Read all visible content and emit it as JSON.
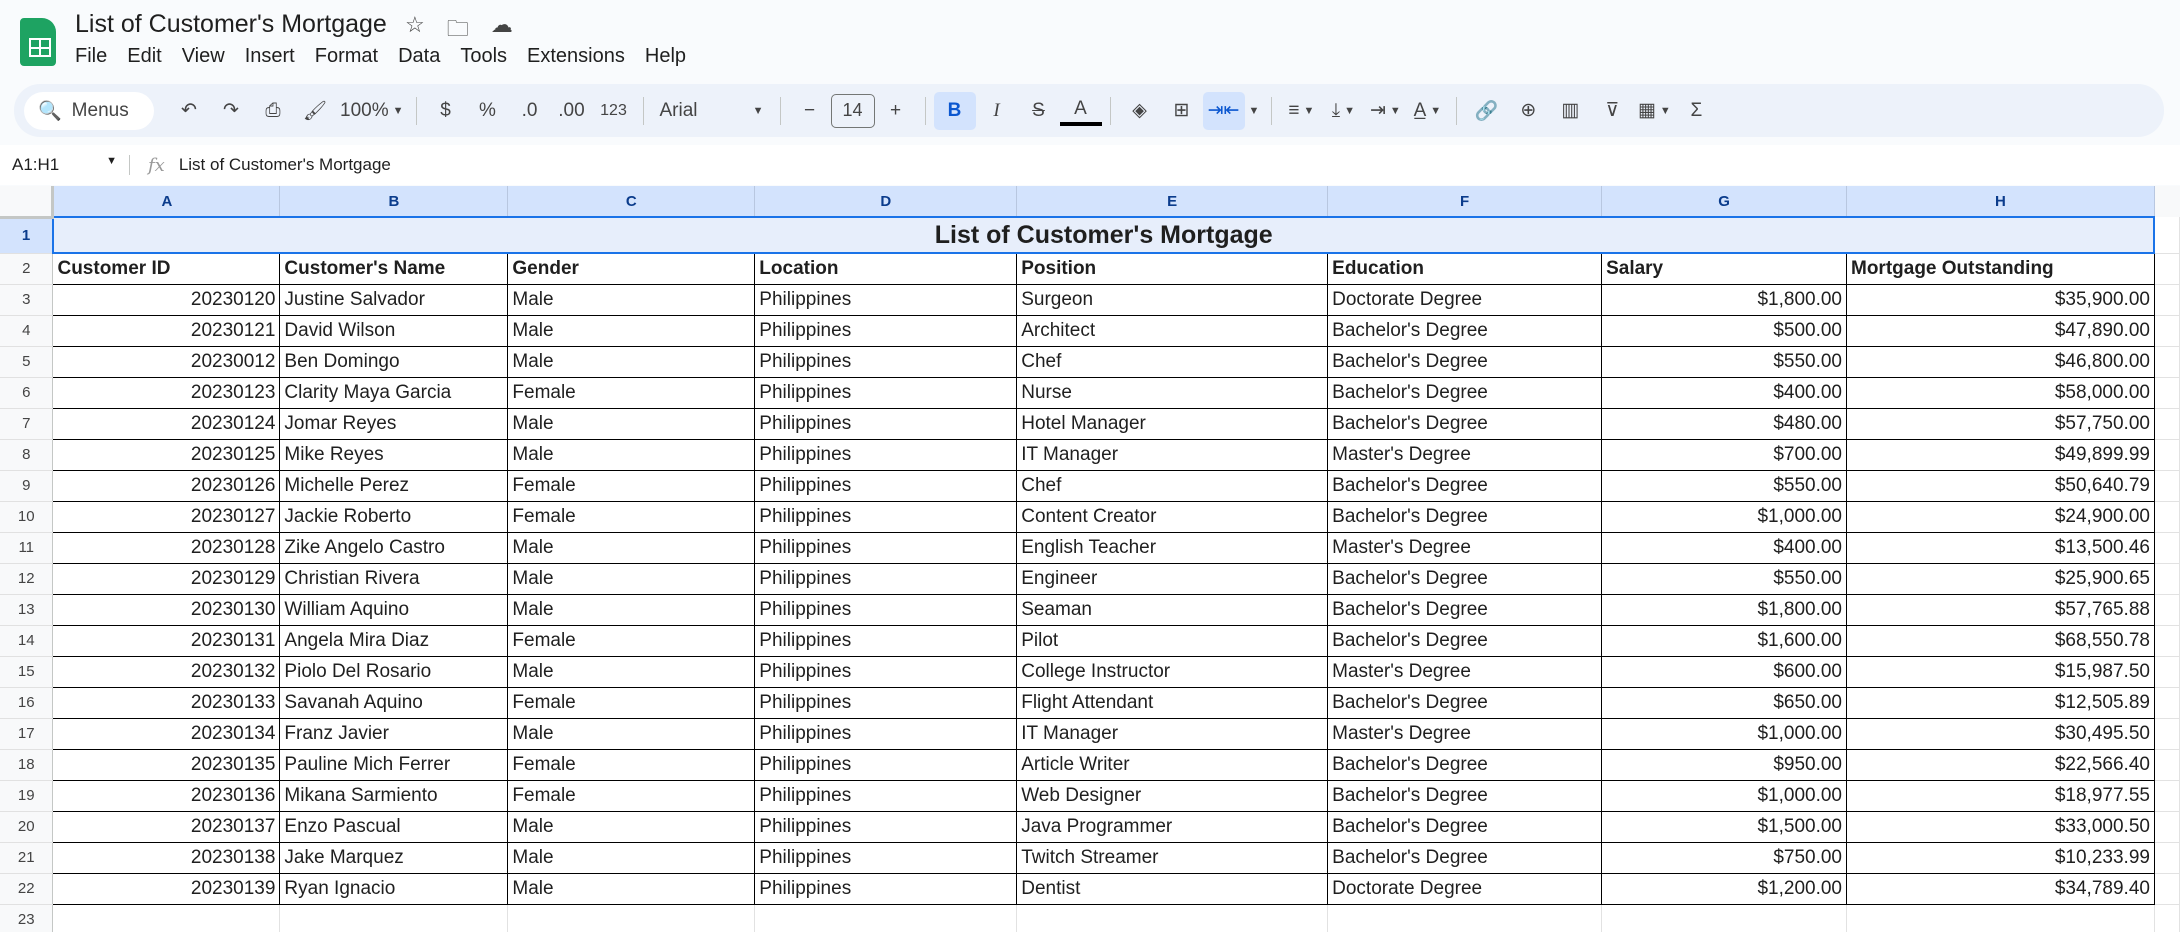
{
  "app": {
    "title": "List of Customer's Mortgage",
    "menu": [
      "File",
      "Edit",
      "View",
      "Insert",
      "Format",
      "Data",
      "Tools",
      "Extensions",
      "Help"
    ]
  },
  "toolbar": {
    "search": "Menus",
    "zoom": "100%",
    "currency": "$",
    "percent": "%",
    "dec_decrease": ".0",
    "dec_increase": ".00",
    "number_format": "123",
    "font": "Arial",
    "font_size": "14",
    "bold": "B",
    "italic": "I",
    "text_color": "A"
  },
  "formula_bar": {
    "name_box": "A1:H1",
    "fx": "fx",
    "content": "List of Customer's Mortgage"
  },
  "sheet": {
    "columns": [
      "A",
      "B",
      "C",
      "D",
      "E",
      "F",
      "G",
      "H"
    ],
    "title": "List of Customer's Mortgage",
    "headers": [
      "Customer ID",
      "Customer's Name",
      "Gender",
      "Location",
      "Position",
      "Education",
      "Salary",
      "Mortgage Outstanding"
    ],
    "rows": [
      [
        "20230120",
        "Justine Salvador",
        "Male",
        "Philippines",
        "Surgeon",
        "Doctorate Degree",
        "$1,800.00",
        "$35,900.00"
      ],
      [
        "20230121",
        "David Wilson",
        "Male",
        "Philippines",
        "Architect",
        "Bachelor's Degree",
        "$500.00",
        "$47,890.00"
      ],
      [
        "20230012",
        "Ben Domingo",
        "Male",
        "Philippines",
        "Chef",
        "Bachelor's Degree",
        "$550.00",
        "$46,800.00"
      ],
      [
        "20230123",
        "Clarity Maya Garcia",
        "Female",
        "Philippines",
        "Nurse",
        "Bachelor's Degree",
        "$400.00",
        "$58,000.00"
      ],
      [
        "20230124",
        "Jomar Reyes",
        "Male",
        "Philippines",
        "Hotel Manager",
        "Bachelor's Degree",
        "$480.00",
        "$57,750.00"
      ],
      [
        "20230125",
        "Mike Reyes",
        "Male",
        "Philippines",
        "IT Manager",
        "Master's Degree",
        "$700.00",
        "$49,899.99"
      ],
      [
        "20230126",
        "Michelle Perez",
        "Female",
        "Philippines",
        "Chef",
        "Bachelor's Degree",
        "$550.00",
        "$50,640.79"
      ],
      [
        "20230127",
        "Jackie Roberto",
        "Female",
        "Philippines",
        "Content Creator",
        "Bachelor's Degree",
        "$1,000.00",
        "$24,900.00"
      ],
      [
        "20230128",
        "Zike Angelo Castro",
        "Male",
        "Philippines",
        "English Teacher",
        "Master's Degree",
        "$400.00",
        "$13,500.46"
      ],
      [
        "20230129",
        "Christian Rivera",
        "Male",
        "Philippines",
        "Engineer",
        "Bachelor's Degree",
        "$550.00",
        "$25,900.65"
      ],
      [
        "20230130",
        "William Aquino",
        "Male",
        "Philippines",
        "Seaman",
        "Bachelor's Degree",
        "$1,800.00",
        "$57,765.88"
      ],
      [
        "20230131",
        "Angela Mira Diaz",
        "Female",
        "Philippines",
        "Pilot",
        "Bachelor's Degree",
        "$1,600.00",
        "$68,550.78"
      ],
      [
        "20230132",
        "Piolo Del Rosario",
        "Male",
        "Philippines",
        "College Instructor",
        "Master's Degree",
        "$600.00",
        "$15,987.50"
      ],
      [
        "20230133",
        "Savanah Aquino",
        "Female",
        "Philippines",
        "Flight Attendant",
        "Bachelor's Degree",
        "$650.00",
        "$12,505.89"
      ],
      [
        "20230134",
        "Franz Javier",
        "Male",
        "Philippines",
        "IT Manager",
        "Master's Degree",
        "$1,000.00",
        "$30,495.50"
      ],
      [
        "20230135",
        "Pauline Mich Ferrer",
        "Female",
        "Philippines",
        "Article Writer",
        "Bachelor's Degree",
        "$950.00",
        "$22,566.40"
      ],
      [
        "20230136",
        "Mikana Sarmiento",
        "Female",
        "Philippines",
        "Web Designer",
        "Bachelor's Degree",
        "$1,000.00",
        "$18,977.55"
      ],
      [
        "20230137",
        "Enzo Pascual",
        "Male",
        "Philippines",
        "Java Programmer",
        "Bachelor's Degree",
        "$1,500.00",
        "$33,000.50"
      ],
      [
        "20230138",
        "Jake Marquez",
        "Male",
        "Philippines",
        "Twitch Streamer",
        "Bachelor's Degree",
        "$750.00",
        "$10,233.99"
      ],
      [
        "20230139",
        "Ryan Ignacio",
        "Male",
        "Philippines",
        "Dentist",
        "Doctorate Degree",
        "$1,200.00",
        "$34,789.40"
      ]
    ]
  }
}
